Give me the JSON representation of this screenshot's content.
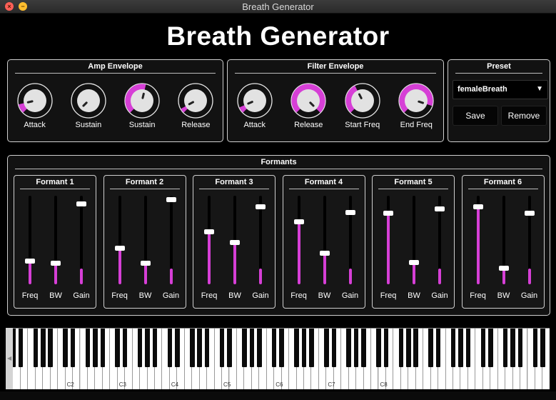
{
  "window": {
    "title": "Breath Generator",
    "close_glyph": "×",
    "min_glyph": "−"
  },
  "app": {
    "title": "Breath Generator"
  },
  "colors": {
    "accent": "#d63fd6",
    "knob_face": "#e2e2e2",
    "panel_border": "#cfcfcf"
  },
  "amp_envelope": {
    "title": "Amp Envelope",
    "knobs": [
      {
        "label": "Attack",
        "value": 0.12
      },
      {
        "label": "Sustain",
        "value": 0.0
      },
      {
        "label": "Sustain",
        "value": 0.55
      },
      {
        "label": "Release",
        "value": 0.06
      }
    ]
  },
  "filter_envelope": {
    "title": "Filter Envelope",
    "knobs": [
      {
        "label": "Attack",
        "value": 0.08
      },
      {
        "label": "Release",
        "value": 1.0
      },
      {
        "label": "Start Freq",
        "value": 0.4
      },
      {
        "label": "End Freq",
        "value": 0.9
      }
    ]
  },
  "preset": {
    "title": "Preset",
    "selected": "femaleBreath",
    "arrow": "▼",
    "save_label": "Save",
    "remove_label": "Remove"
  },
  "formants": {
    "title": "Formants",
    "slider_labels": [
      "Freq",
      "BW",
      "Gain"
    ],
    "items": [
      {
        "title": "Formant 1",
        "values": [
          0.25,
          0.22,
          0.93
        ]
      },
      {
        "title": "Formant 2",
        "values": [
          0.4,
          0.22,
          0.98
        ]
      },
      {
        "title": "Formant 3",
        "values": [
          0.6,
          0.47,
          0.9
        ]
      },
      {
        "title": "Formant 4",
        "values": [
          0.72,
          0.34,
          0.83
        ]
      },
      {
        "title": "Formant 5",
        "values": [
          0.82,
          0.23,
          0.87
        ]
      },
      {
        "title": "Formant 6",
        "values": [
          0.9,
          0.16,
          0.82
        ]
      }
    ]
  },
  "keyboard": {
    "scroll_arrow": "◀",
    "octave_labels": [
      "C2",
      "C3",
      "C4",
      "C5",
      "C6",
      "C7",
      "C8"
    ]
  }
}
